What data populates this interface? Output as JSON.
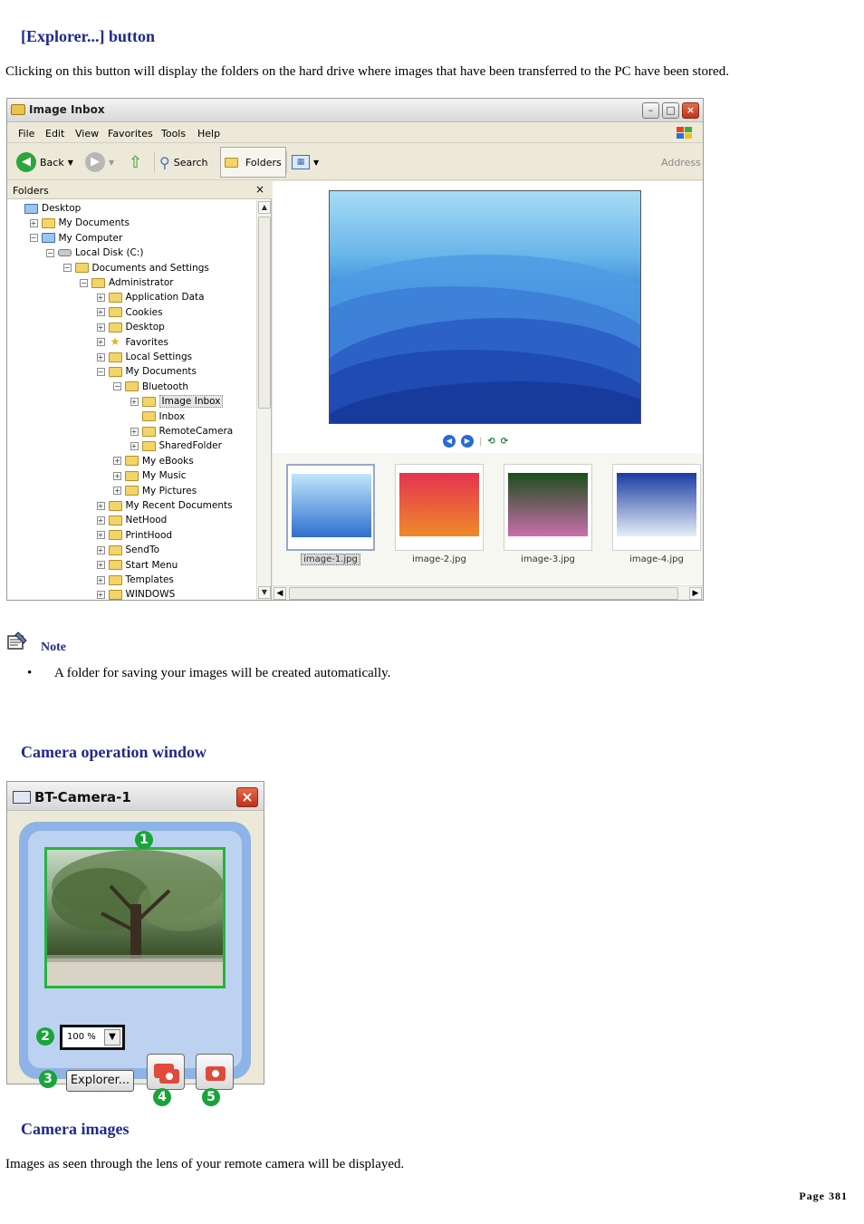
{
  "section1": {
    "heading": "[Explorer...] button",
    "body": "Clicking on this button will display the folders on the hard drive where images that have been transferred to the PC have been stored."
  },
  "explorer_window": {
    "title": "Image Inbox",
    "menu": [
      "File",
      "Edit",
      "View",
      "Favorites",
      "Tools",
      "Help"
    ],
    "toolbar": {
      "back": "Back",
      "search": "Search",
      "folders": "Folders",
      "address": "Address"
    },
    "folders_pane": {
      "header": "Folders",
      "close_glyph": "×",
      "tree": [
        {
          "label": "Desktop",
          "depth": 0,
          "expander": "",
          "icon": "desktop-icon"
        },
        {
          "label": "My Documents",
          "depth": 1,
          "expander": "+",
          "icon": "folder-icon"
        },
        {
          "label": "My Computer",
          "depth": 1,
          "expander": "−",
          "icon": "computer-icon"
        },
        {
          "label": "Local Disk (C:)",
          "depth": 2,
          "expander": "−",
          "icon": "disk-icon"
        },
        {
          "label": "Documents and Settings",
          "depth": 3,
          "expander": "−",
          "icon": "folder-icon"
        },
        {
          "label": "Administrator",
          "depth": 4,
          "expander": "−",
          "icon": "folder-icon"
        },
        {
          "label": "Application Data",
          "depth": 5,
          "expander": "+",
          "icon": "folder-icon"
        },
        {
          "label": "Cookies",
          "depth": 5,
          "expander": "+",
          "icon": "folder-icon"
        },
        {
          "label": "Desktop",
          "depth": 5,
          "expander": "+",
          "icon": "folder-icon"
        },
        {
          "label": "Favorites",
          "depth": 5,
          "expander": "+",
          "icon": "star-icon"
        },
        {
          "label": "Local Settings",
          "depth": 5,
          "expander": "+",
          "icon": "folder-icon"
        },
        {
          "label": "My Documents",
          "depth": 5,
          "expander": "−",
          "icon": "folder-icon"
        },
        {
          "label": "Bluetooth",
          "depth": 6,
          "expander": "−",
          "icon": "folder-icon"
        },
        {
          "label": "Image Inbox",
          "depth": 7,
          "expander": "+",
          "icon": "folder-icon",
          "selected": true
        },
        {
          "label": "Inbox",
          "depth": 7,
          "expander": "",
          "icon": "folder-icon"
        },
        {
          "label": "RemoteCamera",
          "depth": 7,
          "expander": "+",
          "icon": "folder-icon"
        },
        {
          "label": "SharedFolder",
          "depth": 7,
          "expander": "+",
          "icon": "folder-icon"
        },
        {
          "label": "My eBooks",
          "depth": 6,
          "expander": "+",
          "icon": "folder-icon"
        },
        {
          "label": "My Music",
          "depth": 6,
          "expander": "+",
          "icon": "folder-icon"
        },
        {
          "label": "My Pictures",
          "depth": 6,
          "expander": "+",
          "icon": "folder-icon"
        },
        {
          "label": "My Recent Documents",
          "depth": 5,
          "expander": "+",
          "icon": "folder-icon"
        },
        {
          "label": "NetHood",
          "depth": 5,
          "expander": "+",
          "icon": "folder-icon"
        },
        {
          "label": "PrintHood",
          "depth": 5,
          "expander": "+",
          "icon": "folder-icon"
        },
        {
          "label": "SendTo",
          "depth": 5,
          "expander": "+",
          "icon": "folder-icon"
        },
        {
          "label": "Start Menu",
          "depth": 5,
          "expander": "+",
          "icon": "folder-icon"
        },
        {
          "label": "Templates",
          "depth": 5,
          "expander": "+",
          "icon": "folder-icon"
        },
        {
          "label": "WINDOWS",
          "depth": 5,
          "expander": "+",
          "icon": "folder-icon"
        }
      ]
    },
    "thumbnails": [
      {
        "caption": "image-1.jpg",
        "selected": true,
        "colors": [
          "#bfe6fa",
          "#2f6fcf"
        ]
      },
      {
        "caption": "image-2.jpg",
        "selected": false,
        "colors": [
          "#e4334f",
          "#f08a2a"
        ]
      },
      {
        "caption": "image-3.jpg",
        "selected": false,
        "colors": [
          "#1d4d1a",
          "#c96fae"
        ]
      },
      {
        "caption": "image-4.jpg",
        "selected": false,
        "colors": [
          "#1a3ca0",
          "#e6eef8"
        ]
      }
    ]
  },
  "note": {
    "title": "Note",
    "items": [
      "A folder for saving your images will be created automatically."
    ]
  },
  "section2": {
    "heading": "Camera operation window"
  },
  "camera_window": {
    "title": "BT-Camera-1",
    "zoom_value": "100 %",
    "explorer_button": "Explorer...",
    "badges": [
      "1",
      "2",
      "3",
      "4",
      "5"
    ]
  },
  "section3": {
    "heading": "Camera images",
    "body": "Images as seen through the lens of your remote camera will be displayed."
  },
  "footer": {
    "page_label": "Page 381"
  }
}
